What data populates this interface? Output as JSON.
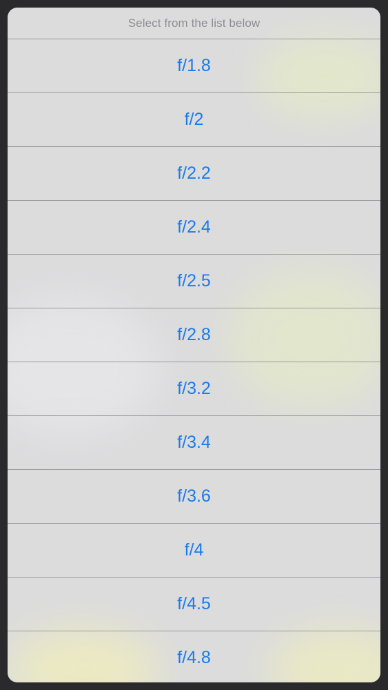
{
  "action_sheet": {
    "header": "Select from the list below",
    "options": [
      {
        "label": "f/1.8"
      },
      {
        "label": "f/2"
      },
      {
        "label": "f/2.2"
      },
      {
        "label": "f/2.4"
      },
      {
        "label": "f/2.5"
      },
      {
        "label": "f/2.8"
      },
      {
        "label": "f/3.2"
      },
      {
        "label": "f/3.4"
      },
      {
        "label": "f/3.6"
      },
      {
        "label": "f/4"
      },
      {
        "label": "f/4.5"
      },
      {
        "label": "f/4.8"
      }
    ]
  },
  "colors": {
    "accent": "#1a7bea",
    "header_text": "#8e8e93",
    "sheet_background": "#dcdcdd",
    "screen_background": "#2a2a2c",
    "separator": "#9a9a9c"
  }
}
